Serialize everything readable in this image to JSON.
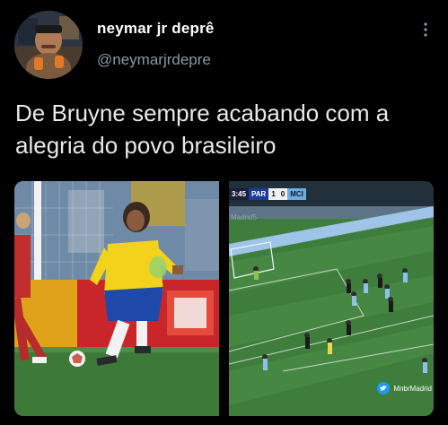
{
  "user": {
    "display_name": "neymar jr deprê",
    "handle": "@neymarjrdepre"
  },
  "tweet": {
    "text": "De Bruyne sempre acabando com a alegria do povo brasileiro"
  },
  "media": {
    "right": {
      "scoreboard": {
        "time": "3:45",
        "team_home": "PAR",
        "score_home": "1",
        "score_away": "0",
        "team_away": "MCI"
      },
      "watermark": "Madrid5",
      "credit": "MnbrMadrid"
    }
  },
  "colors": {
    "background": "#000000",
    "text": "#e7e9ea",
    "muted": "#8b98a5",
    "pitch": "#3d7a3a",
    "brazil_yellow": "#f2d21b",
    "brazil_blue": "#1f49a8"
  },
  "icons": {
    "more": "more-options-icon",
    "twitter": "twitter-bird-icon"
  }
}
